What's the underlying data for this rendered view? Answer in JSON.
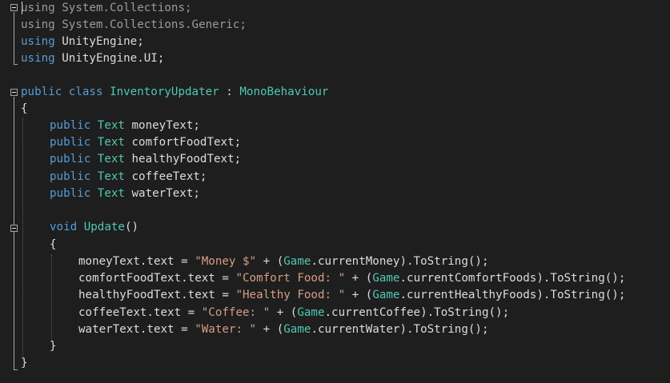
{
  "code": {
    "l1": [
      "using",
      "System.Collections;"
    ],
    "l2": [
      "using",
      "System.Collections.Generic;"
    ],
    "l3": [
      "using",
      "UnityEngine;"
    ],
    "l4": [
      "using",
      "UnityEngine.UI;"
    ],
    "l6": [
      "public",
      "class",
      "InventoryUpdater",
      ":",
      "MonoBehaviour"
    ],
    "l7": "{",
    "l8": [
      "public",
      "Text",
      "moneyText;"
    ],
    "l9": [
      "public",
      "Text",
      "comfortFoodText;"
    ],
    "l10": [
      "public",
      "Text",
      "healthyFoodText;"
    ],
    "l11": [
      "public",
      "Text",
      "coffeeText;"
    ],
    "l12": [
      "public",
      "Text",
      "waterText;"
    ],
    "l14": [
      "void",
      "Update",
      "()"
    ],
    "l15": "{",
    "l16": [
      "moneyText.text = ",
      "\"Money $\"",
      " + (",
      "Game",
      ".currentMoney).ToString();"
    ],
    "l17": [
      "comfortFoodText.text = ",
      "\"Comfort Food: \"",
      " + (",
      "Game",
      ".currentComfortFoods).ToString();"
    ],
    "l18": [
      "healthyFoodText.text = ",
      "\"Healthy Food: \"",
      " + (",
      "Game",
      ".currentHealthyFoods).ToString();"
    ],
    "l19": [
      "coffeeText.text = ",
      "\"Coffee: \"",
      " + (",
      "Game",
      ".currentCoffee).ToString();"
    ],
    "l20": [
      "waterText.text = ",
      "\"Water: \"",
      " + (",
      "Game",
      ".currentWater).ToString();"
    ],
    "l21": "}",
    "l22": "}"
  },
  "colors": {
    "background": "#1e1e1e",
    "keyword": "#569cd6",
    "type": "#4ec9b0",
    "string": "#d69d85",
    "plain": "#dcdcdc"
  }
}
